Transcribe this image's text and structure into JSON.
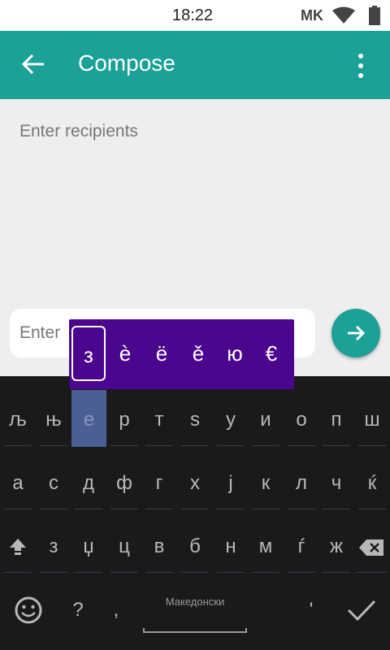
{
  "status_bar": {
    "time": "18:22",
    "carrier": "MK"
  },
  "app_bar": {
    "title": "Compose"
  },
  "compose": {
    "recipients_placeholder": "Enter recipients",
    "message_placeholder": "Enter"
  },
  "popup": {
    "keys": [
      "з",
      "è",
      "ё",
      "ě",
      "ю",
      "€"
    ]
  },
  "keyboard": {
    "row1": [
      "љ",
      "њ",
      "е",
      "р",
      "т",
      "s",
      "у",
      "и",
      "о",
      "п",
      "ш"
    ],
    "row2": [
      "а",
      "с",
      "д",
      "ф",
      "г",
      "х",
      "ј",
      "к",
      "л",
      "ч",
      "ќ"
    ],
    "row3": [
      "з",
      "џ",
      "ц",
      "в",
      "б",
      "н",
      "м",
      "ѓ",
      "ж"
    ],
    "row4": {
      "question": "?",
      "comma": ",",
      "language": "Македонски",
      "apostrophe": "'"
    }
  },
  "colors": {
    "app_bar": "#1ba197",
    "popup": "#4b058f",
    "keyboard_bg": "#1a1a1a",
    "highlight": "#4c5f94"
  },
  "icons": [
    "back-arrow-icon",
    "more-vert-icon",
    "wifi-icon",
    "battery-icon",
    "send-arrow-icon",
    "shift-icon",
    "backspace-icon",
    "emoji-icon",
    "checkmark-icon"
  ]
}
